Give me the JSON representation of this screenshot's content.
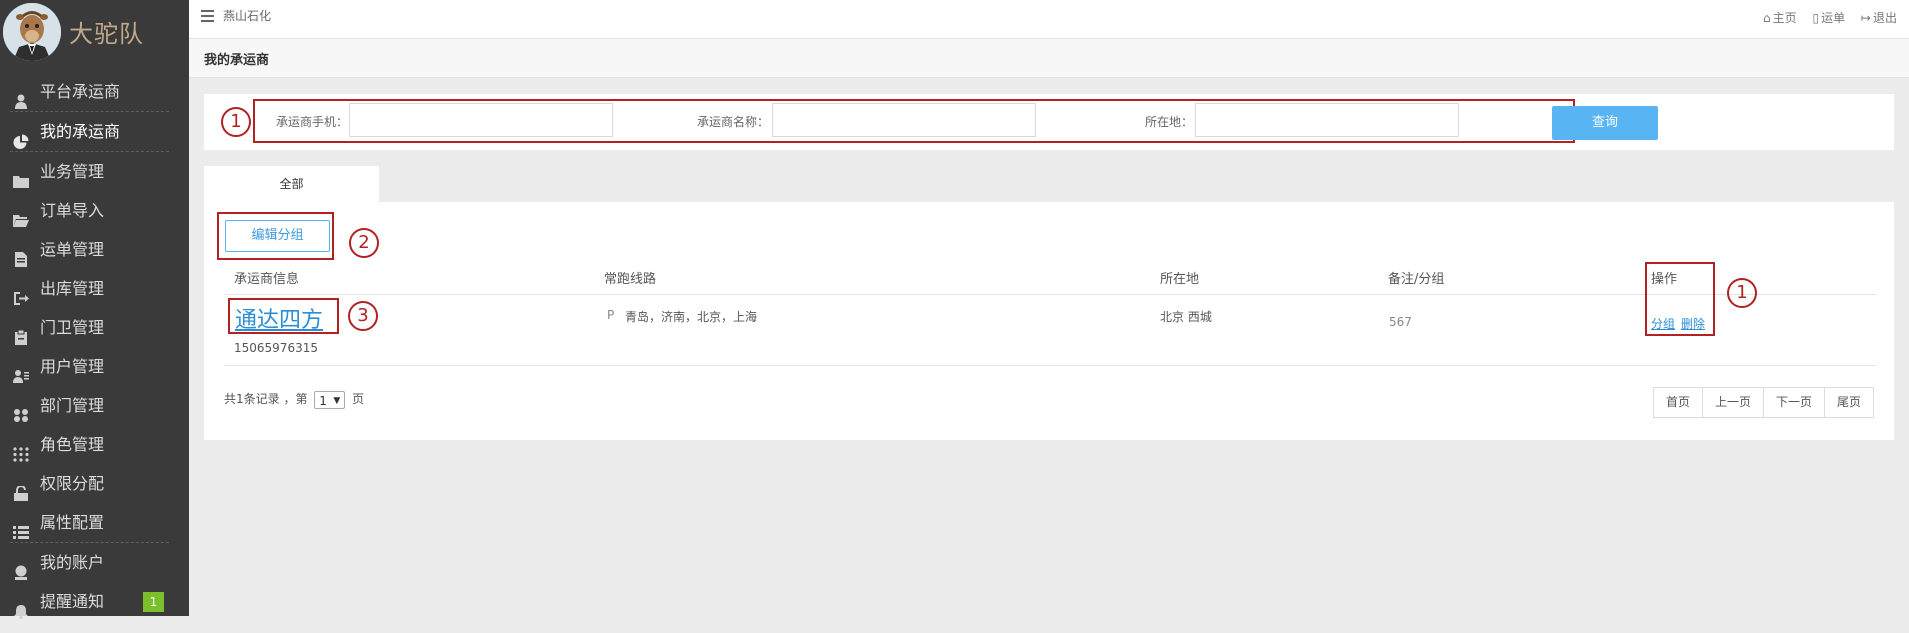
{
  "sidebar": {
    "brand": "大驼队",
    "items": [
      {
        "label": "平台承运商",
        "icon": "user-icon"
      },
      {
        "label": "我的承运商",
        "icon": "pie-chart-icon",
        "active": true
      },
      {
        "label": "业务管理",
        "icon": "folder-icon"
      },
      {
        "label": "订单导入",
        "icon": "folder-open-icon"
      },
      {
        "label": "运单管理",
        "icon": "document-icon"
      },
      {
        "label": "出库管理",
        "icon": "sign-out-icon"
      },
      {
        "label": "门卫管理",
        "icon": "clipboard-icon"
      },
      {
        "label": "用户管理",
        "icon": "user-card-icon"
      },
      {
        "label": "部门管理",
        "icon": "grid-icon"
      },
      {
        "label": "角色管理",
        "icon": "dots-grid-icon"
      },
      {
        "label": "权限分配",
        "icon": "unlock-icon"
      },
      {
        "label": "属性配置",
        "icon": "list-icon"
      },
      {
        "label": "我的账户",
        "icon": "account-icon"
      },
      {
        "label": "提醒通知",
        "icon": "bell-icon",
        "badge": "1"
      }
    ]
  },
  "topbar": {
    "company": "燕山石化",
    "links": [
      {
        "label": "主页",
        "icon": "home-icon"
      },
      {
        "label": "运单",
        "icon": "file-icon"
      },
      {
        "label": "退出",
        "icon": "logout-icon"
      }
    ]
  },
  "page": {
    "title": "我的承运商"
  },
  "filters": {
    "phone_label": "承运商手机：",
    "name_label": "承运商名称：",
    "location_label": "所在地：",
    "phone_value": "",
    "name_value": "",
    "location_value": "",
    "query_label": "查询"
  },
  "annotations": {
    "one": "1",
    "two": "2",
    "three": "3"
  },
  "tabs": [
    {
      "label": "全部",
      "active": true
    }
  ],
  "toolbar": {
    "edit_group_label": "编辑分组"
  },
  "table": {
    "headers": [
      "承运商信息",
      "常跑线路",
      "所在地",
      "备注/分组",
      "操作"
    ],
    "rows": [
      {
        "name": "通达四方",
        "phone": "15065976315",
        "route_icon": "P",
        "route": "青岛，济南，北京，上海",
        "location": "北京 西城",
        "remark": "567",
        "actions": [
          "分组",
          "删除"
        ]
      }
    ]
  },
  "pagination": {
    "summary_prefix": "共1条记录 ，第",
    "page_value": "1",
    "summary_suffix": "页",
    "buttons": [
      "首页",
      "上一页",
      "下一页",
      "尾页"
    ]
  },
  "colors": {
    "sidebar": "#3a3a3a",
    "accent": "#58b4f3",
    "annotation": "#b22222",
    "link": "#2b8fd6",
    "badge": "#7bbf2a"
  }
}
